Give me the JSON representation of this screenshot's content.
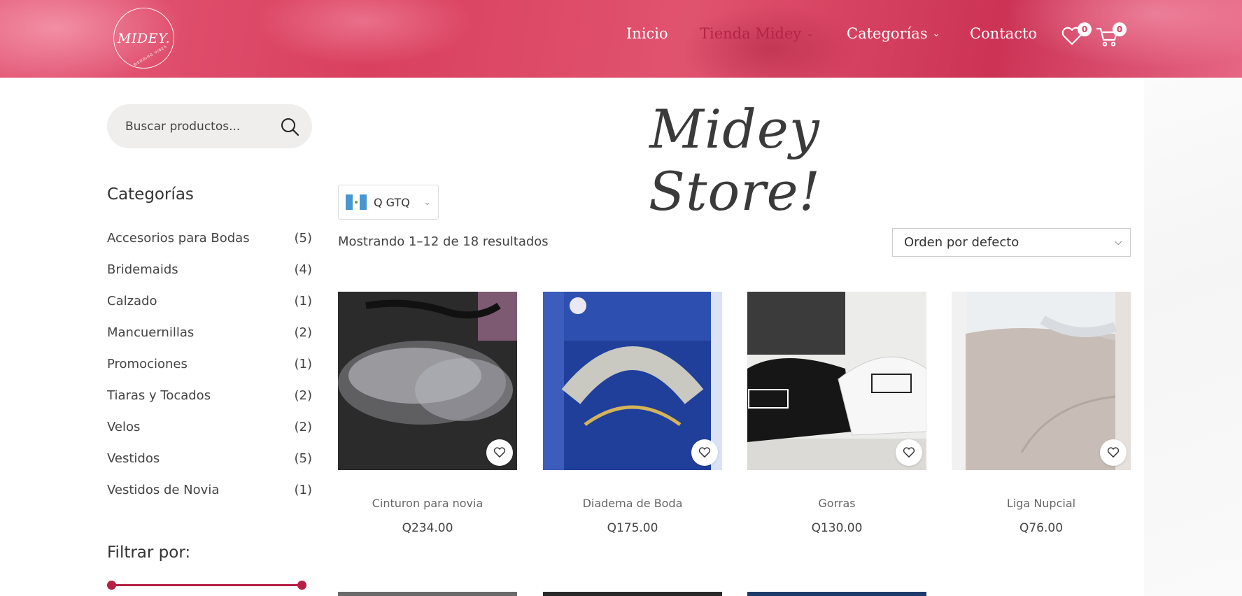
{
  "header": {
    "logo_text": "MIDEY.",
    "logo_subtext": "WEDDING VIBES",
    "nav": [
      {
        "label": "Inicio",
        "has_dropdown": false,
        "active": false
      },
      {
        "label": "Tienda Midey",
        "has_dropdown": true,
        "active": true
      },
      {
        "label": "Categorías",
        "has_dropdown": true,
        "active": false
      },
      {
        "label": "Contacto",
        "has_dropdown": false,
        "active": false
      }
    ],
    "wishlist_count": "0",
    "cart_count": "0"
  },
  "search": {
    "placeholder": "Buscar productos..."
  },
  "sidebar": {
    "categories_title": "Categorías",
    "categories": [
      {
        "name": "Accesorios para Bodas",
        "count": "(5)"
      },
      {
        "name": "Bridemaids",
        "count": "(4)"
      },
      {
        "name": "Calzado",
        "count": "(1)"
      },
      {
        "name": "Mancuernillas",
        "count": "(2)"
      },
      {
        "name": "Promociones",
        "count": "(1)"
      },
      {
        "name": "Tiaras y Tocados",
        "count": "(2)"
      },
      {
        "name": "Velos",
        "count": "(2)"
      },
      {
        "name": "Vestidos",
        "count": "(5)"
      },
      {
        "name": "Vestidos de Novia",
        "count": "(1)"
      }
    ],
    "filter_title": "Filtrar por:",
    "price_range_selected": [
      0,
      1
    ]
  },
  "main": {
    "store_title": "Midey Store!",
    "currency": "Q GTQ",
    "result_count": "Mostrando 1–12 de 18 resultados",
    "orderby": "Orden por defecto",
    "products": [
      {
        "name": "Cinturon para novia",
        "price": "Q234.00",
        "image": "rhinestone-belt"
      },
      {
        "name": "Diadema de Boda",
        "price": "Q175.00",
        "image": "crystal-tiara"
      },
      {
        "name": "Gorras",
        "price": "Q130.00",
        "image": "mr-mrs-caps"
      },
      {
        "name": "Liga Nupcial",
        "price": "Q76.00",
        "image": "bridal-garter"
      }
    ]
  },
  "colors": {
    "brand_pink": "#d9405f",
    "accent_red": "#b81f45"
  }
}
